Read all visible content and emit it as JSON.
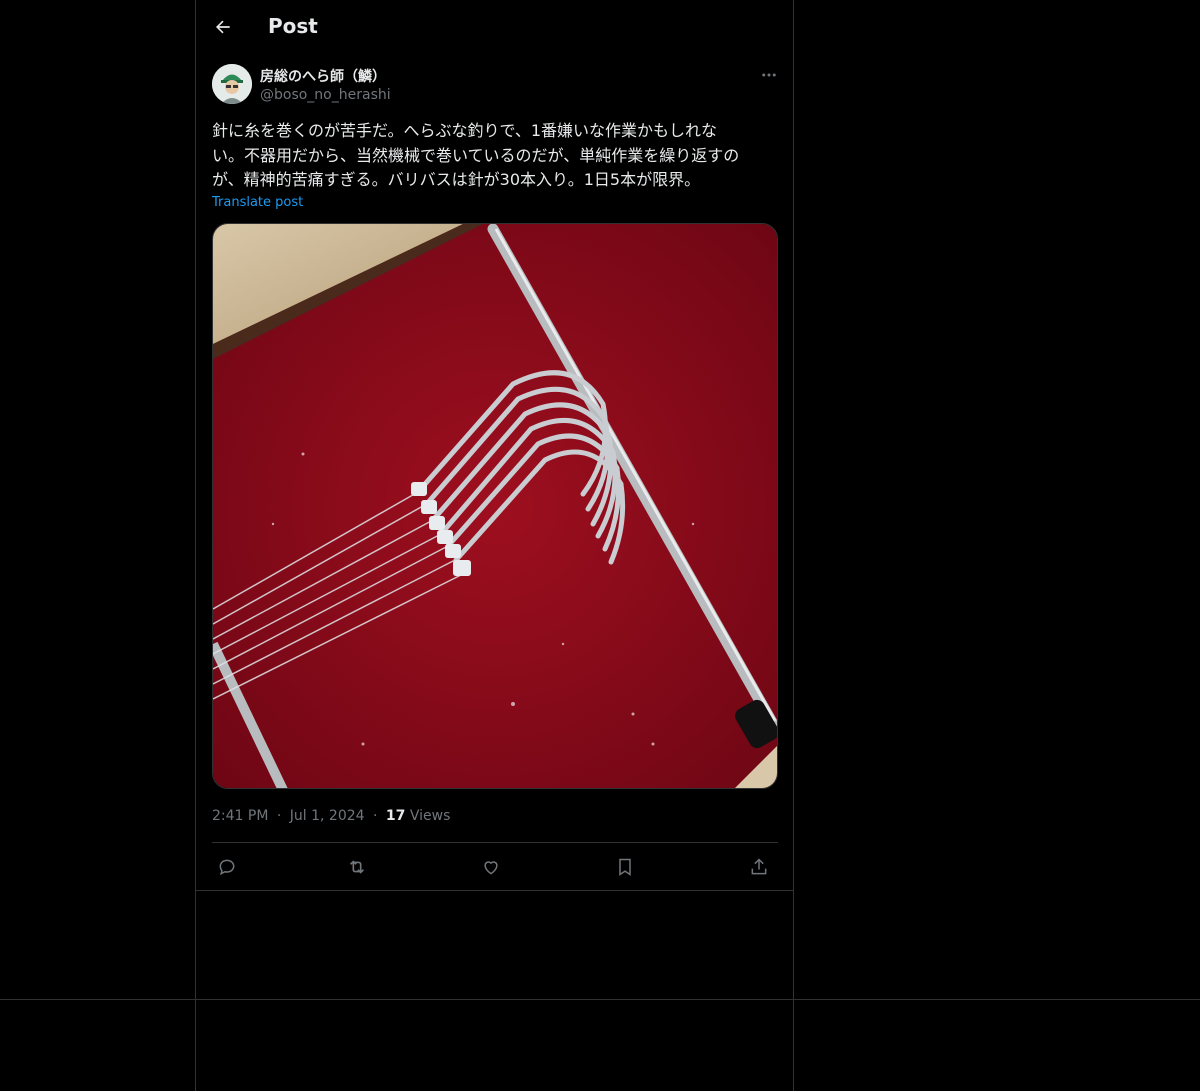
{
  "header": {
    "title": "Post"
  },
  "post": {
    "author_name": "房総のへら師（鱗）",
    "author_handle": "@boso_no_herashi",
    "text": "針に糸を巻くのが苦手だ。へらぶな釣りで、1番嫌いな作業かもしれな\nい。不器用だから、当然機械で巻いているのだが、単純作業を繰り返すの\nが、精神的苦痛すぎる。バリバスは針が30本入り。1日5本が限界。",
    "translate_label": "Translate post",
    "time": "2:41 PM",
    "date": "Jul 1, 2024",
    "views_count": "17",
    "views_label": "Views",
    "separator": "·"
  },
  "icons": {
    "back": "arrow-left-icon",
    "more": "more-horizontal-icon",
    "reply": "reply-icon",
    "retweet": "retweet-icon",
    "like": "heart-icon",
    "bookmark": "bookmark-icon",
    "share": "share-icon"
  },
  "colors": {
    "background": "#000000",
    "text": "#e7e9ea",
    "muted": "#71767b",
    "link": "#1d9bf0",
    "border": "#2f3336"
  }
}
